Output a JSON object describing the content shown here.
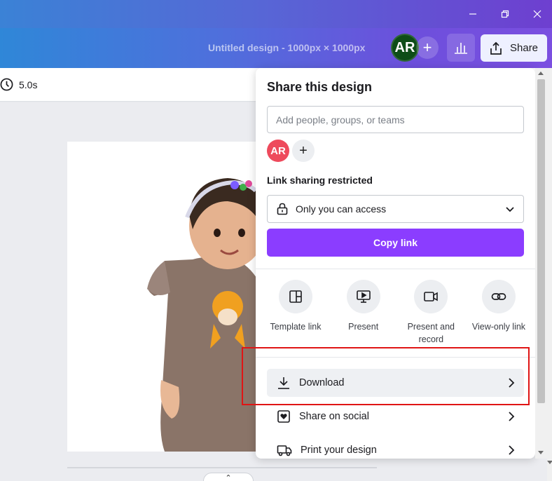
{
  "window": {
    "minimize_icon": "minimize-icon",
    "restore_icon": "restore-icon",
    "close_icon": "close-icon"
  },
  "header": {
    "doc_title": "Untitled design - 1000px × 1000px",
    "avatar_initials": "AR",
    "add_label": "+",
    "share_label": "Share",
    "colors": {
      "avatar_bg": "#0e4d18",
      "share_bg": "#eef0ff"
    }
  },
  "toolbar": {
    "duration": "5.0s"
  },
  "canvas": {
    "bottom_tab_glyph": "⌃"
  },
  "share_panel": {
    "title": "Share this design",
    "people_placeholder": "Add people, groups, or teams",
    "member_initials": "AR",
    "add_member_label": "+",
    "link_heading": "Link sharing restricted",
    "access_value": "Only you can access",
    "copy_link_label": "Copy link",
    "actions": [
      {
        "label": "Template link",
        "icon": "template-icon"
      },
      {
        "label": "Present",
        "icon": "present-icon"
      },
      {
        "label": "Present and record",
        "icon": "camera-icon"
      },
      {
        "label": "View-only link",
        "icon": "link-icon"
      }
    ],
    "menu": [
      {
        "label": "Download",
        "icon": "download-icon"
      },
      {
        "label": "Share on social",
        "icon": "heart-icon"
      },
      {
        "label": "Print your design",
        "icon": "truck-icon"
      }
    ],
    "colors": {
      "accent": "#8b3dff",
      "member_avatar": "#ee4a5c",
      "highlight": "#e01515"
    }
  }
}
